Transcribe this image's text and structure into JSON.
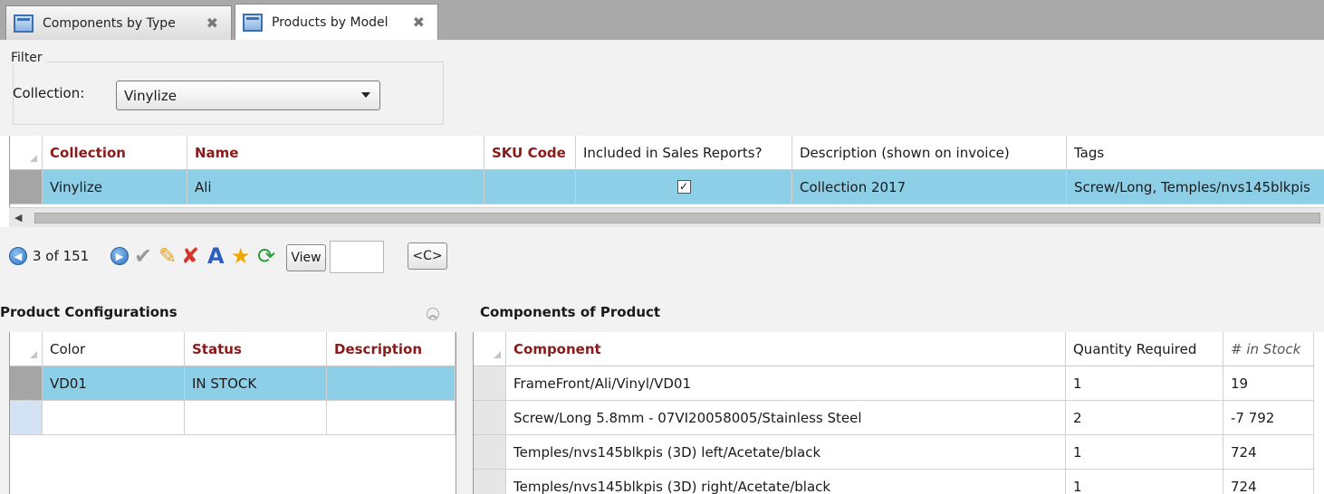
{
  "tabs": [
    {
      "label": "Components by Type"
    },
    {
      "label": "Products by Model"
    }
  ],
  "filter": {
    "legend": "Filter",
    "collection_label": "Collection:",
    "collection_value": "Vinylize"
  },
  "products_grid": {
    "columns": [
      "Collection",
      "Name",
      "SKU Code",
      "Included in Sales Reports?",
      "Description (shown on invoice)",
      "Tags"
    ],
    "rows": [
      {
        "collection": "Vinylize",
        "name": "Ali",
        "sku": "",
        "included": "✓",
        "description": "Collection 2017",
        "tags": "Screw/Long, Temples/nvs145blkpis"
      }
    ]
  },
  "toolbar": {
    "record_position": "3 of 151",
    "view_label": "View",
    "view_input": "",
    "c_label": "<C>"
  },
  "configurations": {
    "title": "Product Configurations",
    "columns": [
      "Color",
      "Status",
      "Description"
    ],
    "rows": [
      {
        "color": "VD01",
        "status": "IN STOCK",
        "description": ""
      }
    ]
  },
  "components": {
    "title": "Components of Product",
    "columns": [
      "Component",
      "Quantity Required",
      "# in Stock"
    ],
    "rows": [
      {
        "component": "FrameFront/Ali/Vinyl/VD01",
        "qty": "1",
        "stock": "19"
      },
      {
        "component": "Screw/Long 5.8mm - 07VI20058005/Stainless Steel",
        "qty": "2",
        "stock": "-7 792"
      },
      {
        "component": "Temples/nvs145blkpis (3D) left/Acetate/black",
        "qty": "1",
        "stock": "724"
      },
      {
        "component": "Temples/nvs145blkpis (3D) right/Acetate/black",
        "qty": "1",
        "stock": "724"
      }
    ]
  },
  "colors": {
    "selected_row": "#8ecfe8",
    "required_header": "#8b1a1a",
    "tabstrip": "#a9a9a9"
  }
}
